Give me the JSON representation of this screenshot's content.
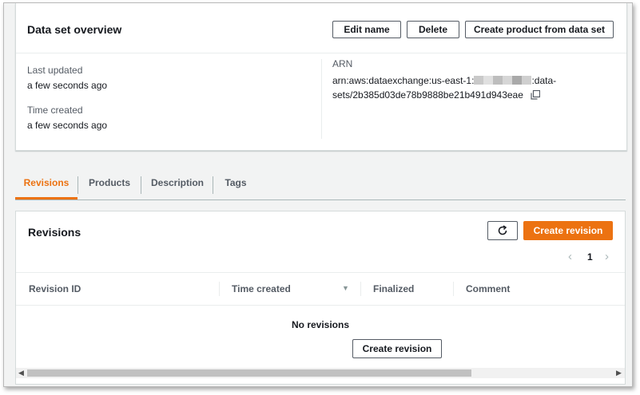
{
  "overview": {
    "title": "Data set overview",
    "buttons": {
      "edit_name": "Edit name",
      "delete": "Delete",
      "create_product": "Create product from data set"
    },
    "last_updated_label": "Last updated",
    "last_updated_value": "a few seconds ago",
    "time_created_label": "Time created",
    "time_created_value": "a few seconds ago",
    "arn_label": "ARN",
    "arn_prefix": "arn:aws:dataexchange:us-east-1:",
    "arn_suffix": ":data-",
    "arn_line2": "sets/2b385d03de78b9888be21b491d943eae"
  },
  "tabs": [
    "Revisions",
    "Products",
    "Description",
    "Tags"
  ],
  "revisions": {
    "title": "Revisions",
    "create_label": "Create revision",
    "page": "1",
    "columns": [
      "Revision ID",
      "Time created",
      "Finalized",
      "Comment"
    ],
    "empty_text": "No revisions",
    "empty_create_label": "Create revision"
  },
  "colors": {
    "accent": "#ec7211",
    "tab_active": "#ec7211"
  }
}
